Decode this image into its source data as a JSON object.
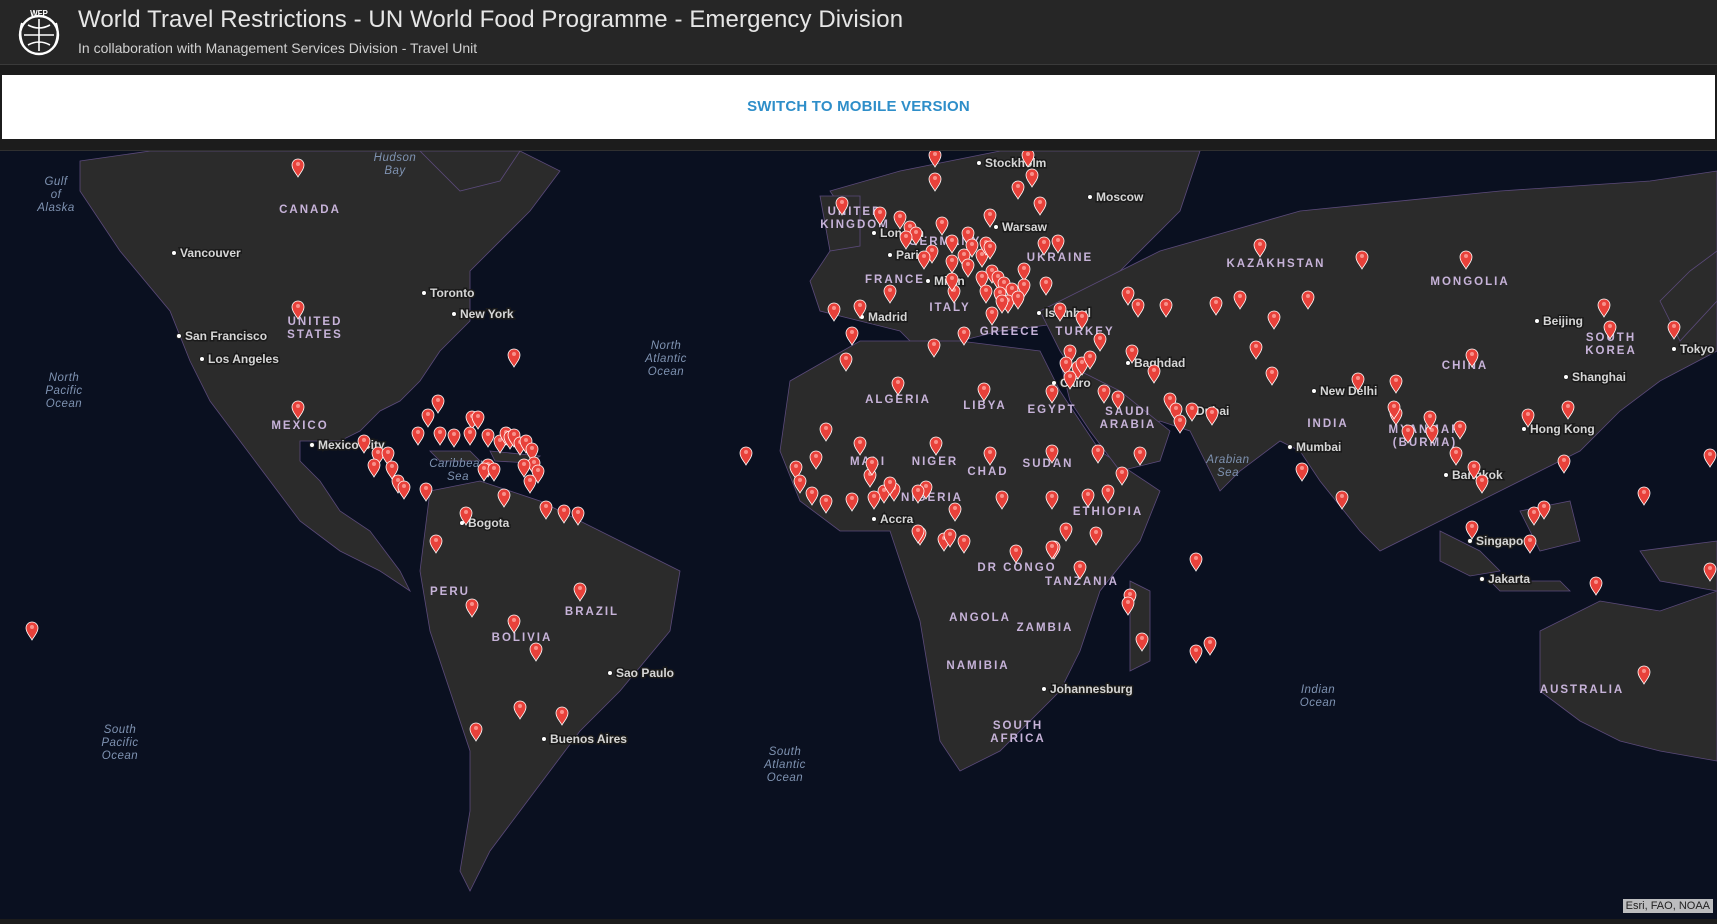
{
  "header": {
    "title": "World Travel Restrictions - UN World Food Programme - Emergency Division",
    "subtitle": "In collaboration with Management Services Division - Travel Unit",
    "logo_text": "WFP"
  },
  "mobile_bar": {
    "switch_label": "SWITCH TO MOBILE VERSION"
  },
  "map": {
    "attribution": "Esri, FAO, NOAA",
    "marker_color": "#e8413a",
    "ocean_color": "#0a1020",
    "land_color": "#2b2b2b",
    "country_labels": [
      "CANADA",
      "UNITED STATES",
      "MEXICO",
      "BRAZIL",
      "PERU",
      "BOLIVIA",
      "UNITED KINGDOM",
      "FRANCE",
      "GERMANY",
      "ITALY",
      "GREECE",
      "UKRAINE",
      "TURKEY",
      "KAZAKHSTAN",
      "MONGOLIA",
      "CHINA",
      "SOUTH KOREA",
      "INDIA",
      "MYANMAR (BURMA)",
      "SAUDI ARABIA",
      "EGYPT",
      "LIBYA",
      "ALGERIA",
      "MALI",
      "NIGER",
      "CHAD",
      "SUDAN",
      "NIGERIA",
      "ETHIOPIA",
      "DR CONGO",
      "TANZANIA",
      "ANGOLA",
      "ZAMBIA",
      "NAMIBIA",
      "SOUTH AFRICA",
      "AUSTRALIA"
    ],
    "ocean_labels": [
      "Gulf of Alaska",
      "Hudson Bay",
      "North Pacific Ocean",
      "North Atlantic Ocean",
      "Caribbean Sea",
      "South Pacific Ocean",
      "South Atlantic Ocean",
      "Arabian Sea",
      "Indian Ocean"
    ],
    "city_labels": [
      "Vancouver",
      "Toronto",
      "New York",
      "San Francisco",
      "Los Angeles",
      "Mexico City",
      "Bogota",
      "Sao Paulo",
      "Buenos Aires",
      "London",
      "Paris",
      "Madrid",
      "Milan",
      "Stockholm",
      "Warsaw",
      "Moscow",
      "Istanbul",
      "Cairo",
      "Baghdad",
      "Dubai",
      "Accra",
      "Johannesburg",
      "New Delhi",
      "Mumbai",
      "Beijing",
      "Shanghai",
      "Hong Kong",
      "Bangkok",
      "Singapore",
      "Jakarta",
      "Tokyo"
    ],
    "marker_count": 206
  }
}
